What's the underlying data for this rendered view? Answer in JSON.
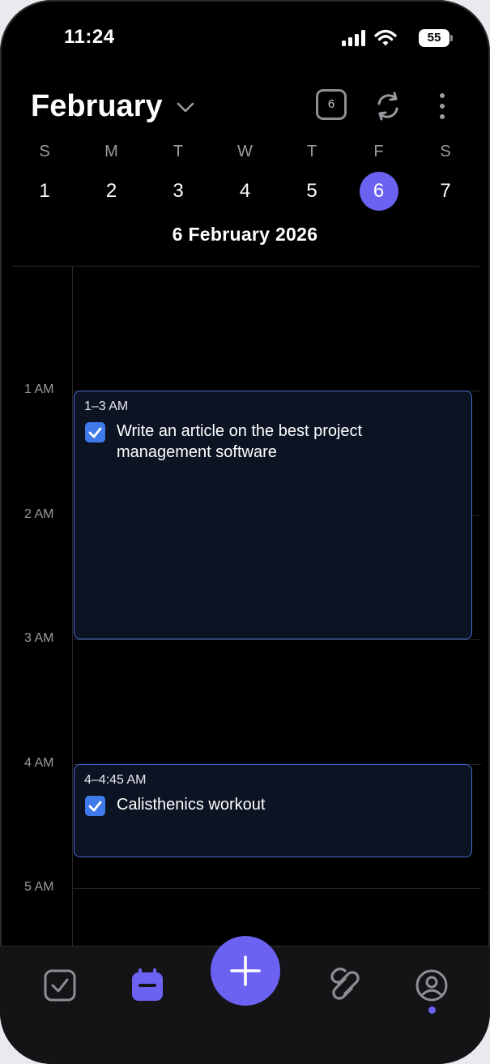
{
  "status_bar": {
    "time": "11:24",
    "battery": "55",
    "icons": [
      "signal-icon",
      "wifi-icon",
      "battery-icon"
    ]
  },
  "header": {
    "month": "February",
    "today_badge": "6",
    "icons": [
      "chevron-down-icon",
      "sync-icon",
      "more-vertical-icon"
    ]
  },
  "week": [
    {
      "letter": "S",
      "num": "1",
      "selected": false
    },
    {
      "letter": "M",
      "num": "2",
      "selected": false
    },
    {
      "letter": "T",
      "num": "3",
      "selected": false
    },
    {
      "letter": "W",
      "num": "4",
      "selected": false
    },
    {
      "letter": "T",
      "num": "5",
      "selected": false
    },
    {
      "letter": "F",
      "num": "6",
      "selected": true
    },
    {
      "letter": "S",
      "num": "7",
      "selected": false
    }
  ],
  "selected_date": "6 February 2026",
  "hours": [
    "1 AM",
    "2 AM",
    "3 AM",
    "4 AM",
    "5 AM"
  ],
  "events": [
    {
      "time": "1–3 AM",
      "title": "Write an article on the best project management software",
      "checked": true
    },
    {
      "time": "4–4:45 AM",
      "title": "Calisthenics workout",
      "checked": true
    }
  ],
  "tabbar": {
    "tabs": [
      "tasks-tab",
      "calendar-tab",
      "add-button",
      "habits-tab",
      "profile-tab"
    ],
    "active": "calendar-tab"
  },
  "colors": {
    "accent": "#6b62f2",
    "event_border": "#4a6cd0",
    "event_fill": "#0c1424",
    "check": "#3f79ea"
  }
}
